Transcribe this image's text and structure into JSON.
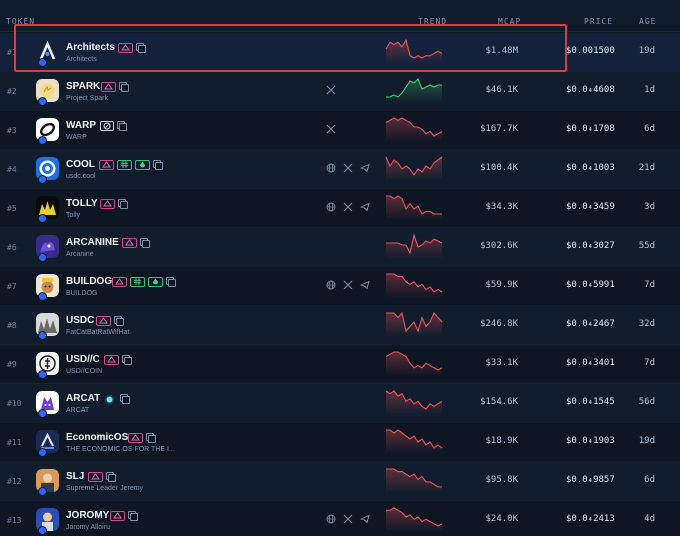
{
  "header": {
    "token": "TOKEN",
    "trend": "TREND",
    "mcap": "MCAP",
    "price": "PRICE",
    "age": "AGE"
  },
  "colors": {
    "down": "#e8555b",
    "up": "#3ecf6e",
    "highlight": "#e0393e"
  },
  "rows": [
    {
      "rank": "#1",
      "name": "Architects",
      "sub": "Architects",
      "mcap": "$1.48M",
      "price": "$0.001500",
      "age": "19d",
      "trend": "down",
      "socials": [],
      "logo": "architects-logo",
      "spark": [
        6,
        9,
        8,
        9,
        7,
        10,
        3,
        2,
        3,
        2,
        3,
        3,
        4,
        5,
        4
      ]
    },
    {
      "rank": "#2",
      "name": "SPARK",
      "sub": "Project Spark",
      "mcap": "$46.1K",
      "price": "$0.0₄4608",
      "age": "1d",
      "trend": "up",
      "socials": [
        "x"
      ],
      "logo": "spark-logo",
      "spark": [
        2,
        2,
        3,
        2,
        4,
        7,
        10,
        9,
        11,
        6,
        7,
        8,
        7,
        8,
        8
      ]
    },
    {
      "rank": "#3",
      "name": "WARP",
      "sub": "WARP",
      "mcap": "$167.7K",
      "price": "$0.0₄1708",
      "age": "6d",
      "trend": "down",
      "socials": [
        "x"
      ],
      "logo": "warp-logo",
      "spark": [
        8,
        9,
        10,
        9,
        10,
        9,
        8,
        6,
        6,
        5,
        3,
        4,
        2,
        3,
        4
      ]
    },
    {
      "rank": "#4",
      "name": "COOL",
      "sub": "usdc.cool",
      "mcap": "$100.4K",
      "price": "$0.0₄1003",
      "age": "21d",
      "trend": "down",
      "socials": [
        "web",
        "x",
        "tg"
      ],
      "logo": "cool-logo",
      "spark": [
        9,
        6,
        8,
        7,
        5,
        6,
        5,
        3,
        5,
        4,
        6,
        5,
        7,
        8,
        9
      ]
    },
    {
      "rank": "#5",
      "name": "TOLLY",
      "sub": "Tolly",
      "mcap": "$34.3K",
      "price": "$0.0₄3459",
      "age": "3d",
      "trend": "down",
      "socials": [
        "web",
        "x",
        "tg"
      ],
      "logo": "tolly-logo",
      "spark": [
        10,
        10,
        9,
        10,
        9,
        5,
        7,
        5,
        6,
        3,
        4,
        4,
        3,
        3,
        3
      ]
    },
    {
      "rank": "#6",
      "name": "ARCANINE",
      "sub": "Arcanine",
      "mcap": "$302.6K",
      "price": "$0.0₄3027",
      "age": "55d",
      "trend": "down",
      "socials": [],
      "logo": "arcanine-logo",
      "spark": [
        7,
        7,
        7,
        7,
        6,
        6,
        2,
        11,
        5,
        6,
        8,
        7,
        9,
        8,
        7
      ]
    },
    {
      "rank": "#7",
      "name": "BUILDOG",
      "sub": "BUILDOG",
      "mcap": "$59.9K",
      "price": "$0.0₄5991",
      "age": "7d",
      "trend": "down",
      "socials": [
        "web",
        "x",
        "tg"
      ],
      "logo": "buildog-logo",
      "spark": [
        10,
        10,
        10,
        9,
        9,
        7,
        6,
        7,
        5,
        6,
        4,
        5,
        3,
        4,
        3
      ]
    },
    {
      "rank": "#8",
      "name": "USDC",
      "sub": "FatCatBatRatWifHat",
      "mcap": "$246.8K",
      "price": "$0.0₄2467",
      "age": "32d",
      "trend": "down",
      "socials": [],
      "logo": "usdc-logo",
      "spark": [
        9,
        9,
        9,
        8,
        9,
        5,
        6,
        7,
        5,
        8,
        6,
        7,
        9,
        8,
        7
      ]
    },
    {
      "rank": "#9",
      "name": "USD//C",
      "sub": "USD//COIN",
      "mcap": "$33.1K",
      "price": "$0.0₄3401",
      "age": "7d",
      "trend": "down",
      "socials": [],
      "logo": "usdc2-logo",
      "spark": [
        8,
        9,
        10,
        10,
        9,
        8,
        5,
        3,
        4,
        3,
        5,
        4,
        3,
        2,
        3
      ]
    },
    {
      "rank": "#10",
      "name": "ARCAT",
      "sub": "ARCAT",
      "mcap": "$154.6K",
      "price": "$0.0₄1545",
      "age": "56d",
      "trend": "down",
      "socials": [],
      "logo": "arcat-logo",
      "spark": [
        10,
        9,
        10,
        8,
        9,
        6,
        7,
        5,
        6,
        4,
        3,
        5,
        4,
        5,
        6
      ]
    },
    {
      "rank": "#11",
      "name": "EconomicOS",
      "sub": "THE ECONOMIC OS FOR THE I...",
      "mcap": "$18.9K",
      "price": "$0.0₄1903",
      "age": "19d",
      "trend": "down",
      "socials": [],
      "logo": "economicos-logo",
      "spark": [
        10,
        10,
        9,
        10,
        9,
        8,
        7,
        8,
        6,
        7,
        5,
        6,
        4,
        5,
        4
      ]
    },
    {
      "rank": "#12",
      "name": "SLJ",
      "sub": "Supreme Leader Jeremy",
      "mcap": "$95.8K",
      "price": "$0.0₄9857",
      "age": "6d",
      "trend": "down",
      "socials": [],
      "logo": "slj-logo",
      "spark": [
        10,
        10,
        10,
        9,
        9,
        8,
        7,
        8,
        6,
        7,
        5,
        5,
        4,
        3,
        3
      ]
    },
    {
      "rank": "#13",
      "name": "JOROMY",
      "sub": "Joromy Alloiru",
      "mcap": "$24.0K",
      "price": "$0.0₄2413",
      "age": "4d",
      "trend": "down",
      "socials": [
        "web",
        "x",
        "tg"
      ],
      "logo": "joromy-logo",
      "spark": [
        9,
        9,
        10,
        9,
        8,
        6,
        7,
        5,
        6,
        4,
        5,
        4,
        3,
        2,
        3
      ]
    }
  ]
}
